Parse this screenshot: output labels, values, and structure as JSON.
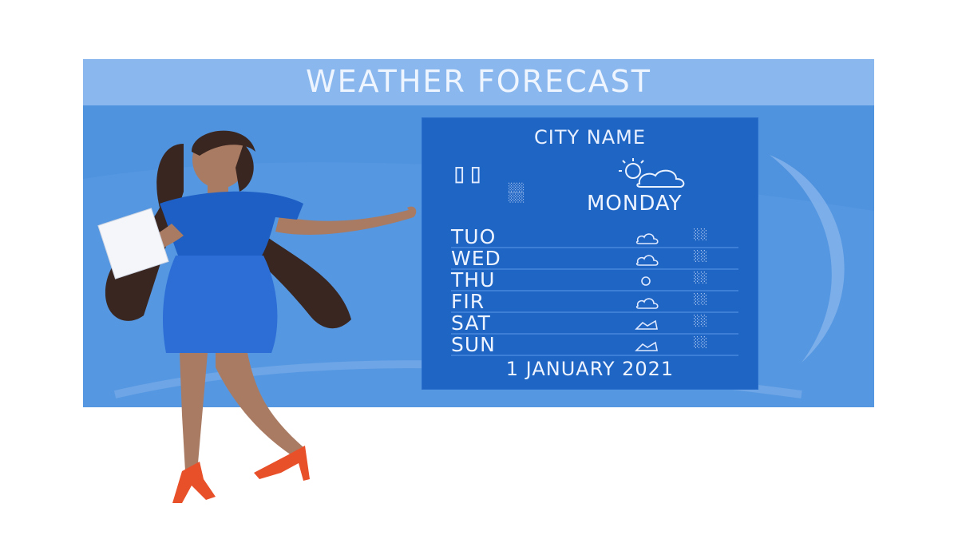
{
  "board": {
    "title": "WEATHER FORECAST"
  },
  "forecast": {
    "city": "CITY NAME",
    "current": {
      "day": "MONDAY"
    },
    "days": [
      {
        "day": "TUO",
        "icon": "cloud-icon"
      },
      {
        "day": "WED",
        "icon": "cloud-icon"
      },
      {
        "day": "THU",
        "icon": "sun-icon"
      },
      {
        "day": "FIR",
        "icon": "cloud-icon"
      },
      {
        "day": "SAT",
        "icon": "partly-cloudy-icon"
      },
      {
        "day": "SUN",
        "icon": "partly-cloudy-icon"
      }
    ],
    "date": "1 JANUARY 2021"
  },
  "colors": {
    "board": "#4f92dd",
    "header": "#8ab8ee",
    "panel": "#1f65c4",
    "text": "#eef4ff",
    "dress": "#1d5fc4",
    "shoes": "#e8502a",
    "hair": "#3a2620",
    "skin": "#a97b63"
  }
}
